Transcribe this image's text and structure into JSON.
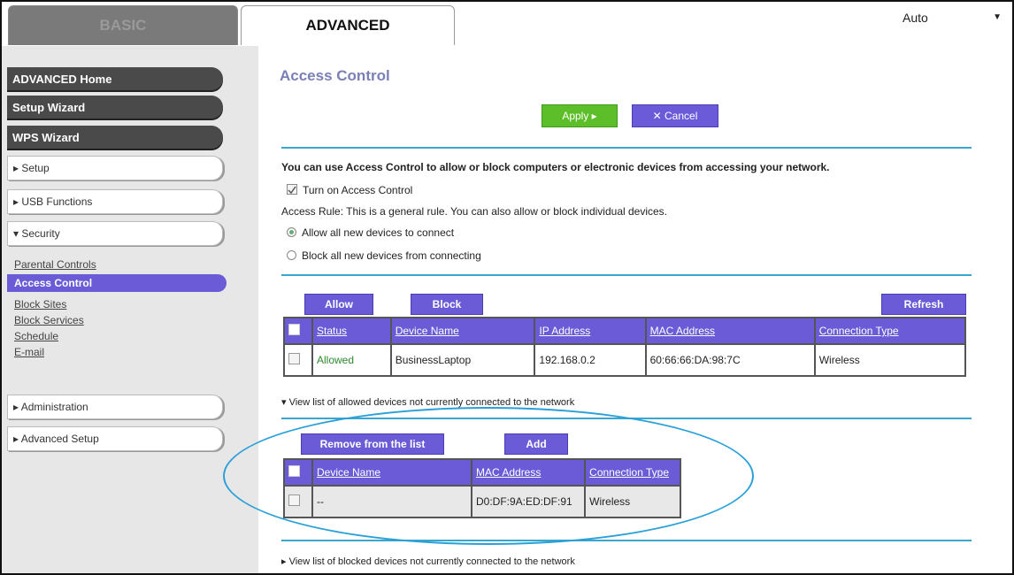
{
  "tabs": {
    "basic_label": "BASIC",
    "advanced_label": "ADVANCED",
    "language_select": "Auto"
  },
  "sidebar": {
    "top_buttons": [
      "ADVANCED Home",
      "Setup Wizard",
      "WPS Wizard"
    ],
    "menus": [
      "▸ Setup",
      "▸ USB Functions",
      "▾ Security"
    ],
    "security_links": [
      "Parental Controls",
      "Access Control",
      "Block Sites",
      "Block Services",
      "Schedule",
      "E-mail"
    ],
    "bottom_menus": [
      "▸ Administration",
      "▸ Advanced Setup"
    ]
  },
  "main": {
    "title": "Access Control",
    "apply_label": "Apply ▸",
    "cancel_label": "✕ Cancel",
    "intro": "You can use Access Control to allow or block computers or electronic devices from accessing your network.",
    "turn_on_label": "Turn on Access Control",
    "access_rule_text": "Access Rule: This is a general rule. You can also allow or block individual devices.",
    "radio_allow": "Allow all new devices to connect",
    "radio_block": "Block all new devices from connecting",
    "allow_button": "Allow",
    "block_button": "Block",
    "refresh_button": "Refresh",
    "device_table": {
      "headers": [
        "Status",
        "Device Name",
        "IP Address",
        "MAC Address",
        "Connection Type"
      ],
      "rows": [
        {
          "status": "Allowed",
          "device_name": "BusinessLaptop",
          "ip": "192.168.0.2",
          "mac": "60:66:66:DA:98:7C",
          "connection": "Wireless"
        }
      ]
    },
    "allowed_not_connected_toggle": "▾ View list of allowed devices not currently connected to the network",
    "remove_button": "Remove from the list",
    "add_button": "Add",
    "offline_table": {
      "headers": [
        "Device Name",
        "MAC Address",
        "Connection Type"
      ],
      "rows": [
        {
          "device_name": "--",
          "mac": "D0:DF:9A:ED:DF:91",
          "connection": "Wireless"
        }
      ]
    },
    "blocked_not_connected_toggle": "▸ View list of blocked devices not currently connected to the network"
  }
}
